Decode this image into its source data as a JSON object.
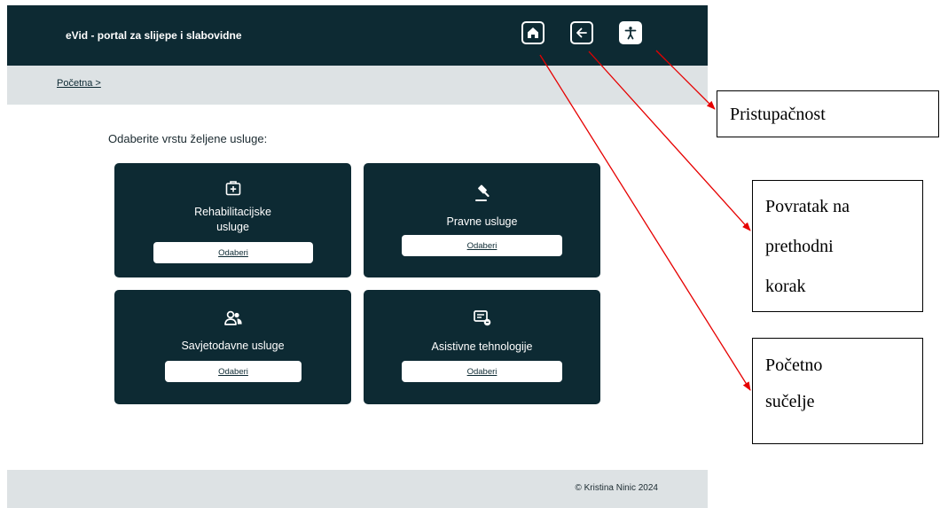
{
  "header": {
    "app_title": "eVid - portal za slijepe i slabovidne"
  },
  "breadcrumb": {
    "label": "Početna >"
  },
  "main": {
    "prompt": "Odaberite vrstu željene usluge:",
    "cards": [
      {
        "icon": "first-aid-kit-icon",
        "title_lines": [
          "Rehabilitacijske",
          "usluge"
        ],
        "button_label": "Odaberi"
      },
      {
        "icon": "gavel-icon",
        "title_lines": [
          "Pravne usluge"
        ],
        "button_label": "Odaberi"
      },
      {
        "icon": "users-icon",
        "title_lines": [
          "Savjetodavne usluge"
        ],
        "button_label": "Odaberi"
      },
      {
        "icon": "assistive-device-icon",
        "title_lines": [
          "Asistivne tehnologije"
        ],
        "button_label": "Odaberi"
      }
    ]
  },
  "footer": {
    "copyright": "© Kristina Ninic 2024"
  },
  "annotations": {
    "accessibility": "Pristupačnost",
    "back_lines": [
      "Povratak na",
      "prethodni",
      "korak"
    ],
    "home_lines": [
      "Početno",
      "sučelje"
    ]
  },
  "colors": {
    "primary_dark": "#0d2a33",
    "light_gray": "#dde2e4",
    "arrow_red": "#e60000"
  }
}
